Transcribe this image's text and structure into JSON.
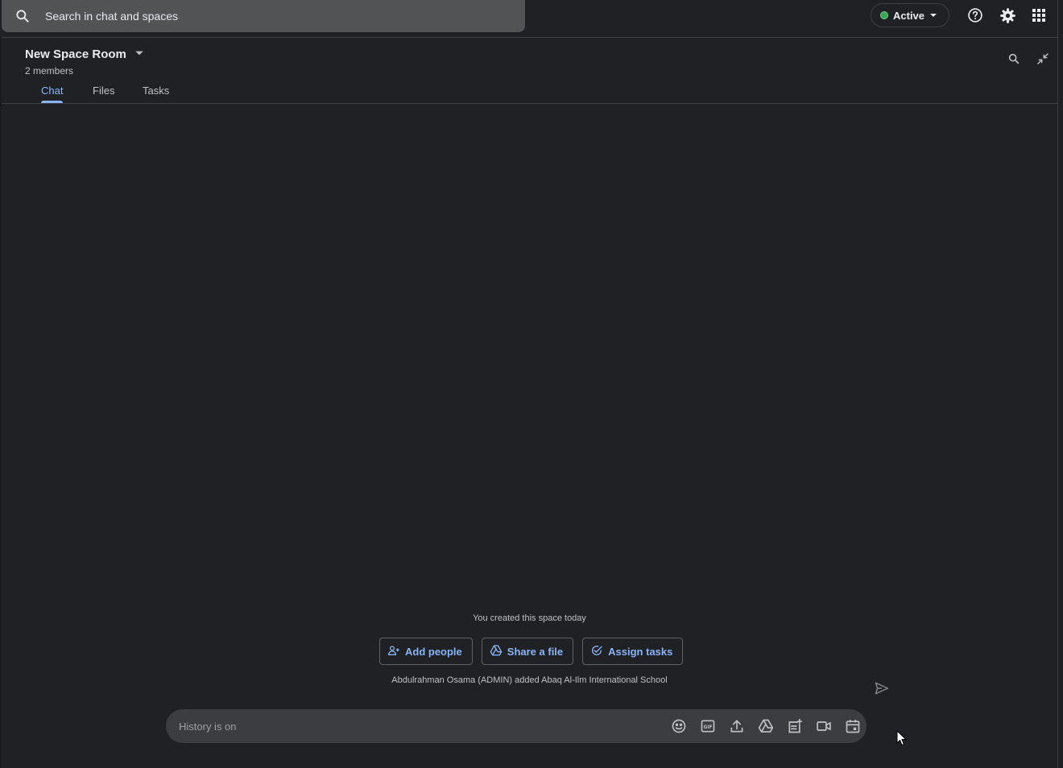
{
  "search": {
    "placeholder": "Search in chat and spaces"
  },
  "status": {
    "label": "Active",
    "color": "#34a853"
  },
  "top_icons": [
    "help-icon",
    "gear-icon",
    "apps-grid-icon"
  ],
  "space": {
    "title": "New Space Room",
    "members": "2 members"
  },
  "tabs": [
    {
      "label": "Chat",
      "active": true
    },
    {
      "label": "Files",
      "active": false
    },
    {
      "label": "Tasks",
      "active": false
    }
  ],
  "intro": {
    "created": "You created this space today",
    "actions": [
      {
        "label": "Add people",
        "icon": "add-person-icon"
      },
      {
        "label": "Share a file",
        "icon": "drive-icon"
      },
      {
        "label": "Assign tasks",
        "icon": "task-check-icon"
      }
    ],
    "added": "Abdulrahman Osama (ADMIN) added Abaq Al-Ilm International School"
  },
  "composer": {
    "placeholder": "History is on",
    "icons": [
      "emoji-icon",
      "gif-icon",
      "upload-icon",
      "drive-icon",
      "integrations-icon",
      "video-icon",
      "calendar-icon"
    ]
  },
  "colors": {
    "accent": "#8ab4f8",
    "background": "#202124"
  }
}
